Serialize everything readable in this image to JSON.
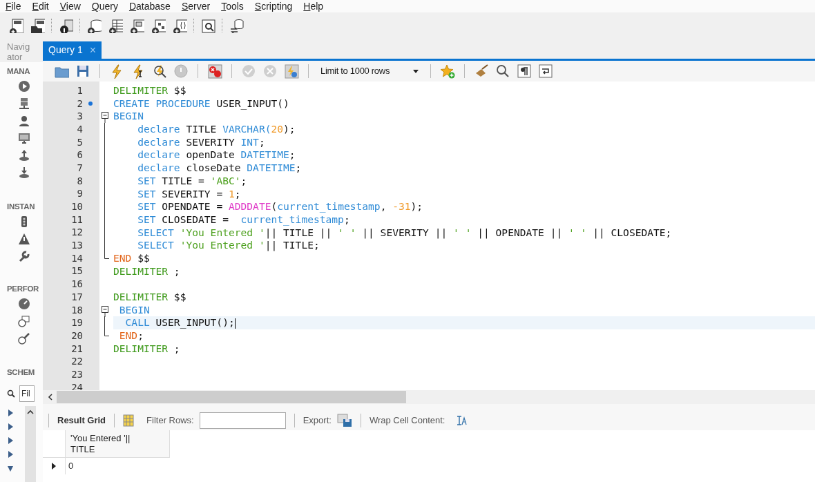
{
  "menu": [
    "File",
    "Edit",
    "View",
    "Query",
    "Database",
    "Server",
    "Tools",
    "Scripting",
    "Help"
  ],
  "navigator": {
    "title_lines": [
      "Navig",
      "ator"
    ],
    "sections": [
      {
        "label": "MANA"
      },
      {
        "label": "INSTAN"
      },
      {
        "label": "PERFOR"
      },
      {
        "label": "SCHEM"
      }
    ],
    "filter_placeholder": "Fil"
  },
  "tabs": [
    {
      "label": "Query 1",
      "close": "×",
      "selected": true
    }
  ],
  "limit_select": {
    "value": "Limit to 1000 rows"
  },
  "editor": {
    "lines": [
      {
        "number": "1",
        "kind": "plain",
        "tokens": [
          {
            "kind": "delimiter",
            "text": "DELIMITER"
          },
          {
            "kind": "text",
            "text": " $$"
          }
        ]
      },
      {
        "number": "2",
        "kind": "plain",
        "marker": true,
        "tokens": [
          {
            "kind": "keyword",
            "text": "CREATE PROCEDURE"
          },
          {
            "kind": "text",
            "text": " USER_INPUT()"
          }
        ]
      },
      {
        "number": "3",
        "kind": "opener",
        "tokens": [
          {
            "kind": "keyword",
            "text": "BEGIN"
          }
        ]
      },
      {
        "number": "4",
        "kind": "inner",
        "tokens": [
          {
            "kind": "keyword",
            "text": "    declare"
          },
          {
            "kind": "text",
            "text": " TITLE "
          },
          {
            "kind": "keyword",
            "text": "VARCHAR("
          },
          {
            "kind": "number",
            "text": "20"
          },
          {
            "kind": "text",
            "text": ");"
          }
        ]
      },
      {
        "number": "5",
        "kind": "inner",
        "tokens": [
          {
            "kind": "keyword",
            "text": "    declare"
          },
          {
            "kind": "text",
            "text": " SEVERITY "
          },
          {
            "kind": "keyword",
            "text": "INT"
          },
          {
            "kind": "text",
            "text": ";"
          }
        ]
      },
      {
        "number": "6",
        "kind": "inner",
        "tokens": [
          {
            "kind": "keyword",
            "text": "    declare"
          },
          {
            "kind": "text",
            "text": " openDate "
          },
          {
            "kind": "keyword",
            "text": "DATETIME"
          },
          {
            "kind": "text",
            "text": ";"
          }
        ]
      },
      {
        "number": "7",
        "kind": "inner",
        "tokens": [
          {
            "kind": "keyword",
            "text": "    declare"
          },
          {
            "kind": "text",
            "text": " closeDate "
          },
          {
            "kind": "keyword",
            "text": "DATETIME"
          },
          {
            "kind": "text",
            "text": ";"
          }
        ]
      },
      {
        "number": "8",
        "kind": "inner",
        "tokens": [
          {
            "kind": "keyword",
            "text": "    SET"
          },
          {
            "kind": "text",
            "text": " TITLE = "
          },
          {
            "kind": "string",
            "text": "'ABC'"
          },
          {
            "kind": "text",
            "text": ";"
          }
        ]
      },
      {
        "number": "9",
        "kind": "inner",
        "tokens": [
          {
            "kind": "keyword",
            "text": "    SET"
          },
          {
            "kind": "text",
            "text": " SEVERITY = "
          },
          {
            "kind": "number",
            "text": "1"
          },
          {
            "kind": "text",
            "text": ";"
          }
        ]
      },
      {
        "number": "10",
        "kind": "inner",
        "tokens": [
          {
            "kind": "keyword",
            "text": "    SET"
          },
          {
            "kind": "text",
            "text": " OPENDATE = "
          },
          {
            "kind": "function",
            "text": "ADDDATE"
          },
          {
            "kind": "text",
            "text": "("
          },
          {
            "kind": "keyword",
            "text": "current_timestamp"
          },
          {
            "kind": "text",
            "text": ", "
          },
          {
            "kind": "number",
            "text": "-31"
          },
          {
            "kind": "text",
            "text": ");"
          }
        ]
      },
      {
        "number": "11",
        "kind": "inner",
        "tokens": [
          {
            "kind": "keyword",
            "text": "    SET"
          },
          {
            "kind": "text",
            "text": " CLOSEDATE =  "
          },
          {
            "kind": "keyword",
            "text": "current_timestamp"
          },
          {
            "kind": "text",
            "text": ";"
          }
        ]
      },
      {
        "number": "12",
        "kind": "inner",
        "tokens": [
          {
            "kind": "keyword",
            "text": "    SELECT"
          },
          {
            "kind": "string",
            "text": " 'You Entered '"
          },
          {
            "kind": "text",
            "text": "|| TITLE || "
          },
          {
            "kind": "string",
            "text": "' '"
          },
          {
            "kind": "text",
            "text": " || SEVERITY || "
          },
          {
            "kind": "string",
            "text": "' '"
          },
          {
            "kind": "text",
            "text": " || OPENDATE || "
          },
          {
            "kind": "string",
            "text": "' '"
          },
          {
            "kind": "text",
            "text": " || CLOSEDATE;"
          }
        ]
      },
      {
        "number": "13",
        "kind": "inner",
        "tokens": [
          {
            "kind": "keyword",
            "text": "    SELECT"
          },
          {
            "kind": "string",
            "text": " 'You Entered '"
          },
          {
            "kind": "text",
            "text": "|| TITLE;"
          }
        ]
      },
      {
        "number": "14",
        "kind": "closer",
        "tokens": [
          {
            "kind": "end",
            "text": "END"
          },
          {
            "kind": "text",
            "text": " $$"
          }
        ]
      },
      {
        "number": "15",
        "kind": "plain",
        "tokens": [
          {
            "kind": "delimiter",
            "text": "DELIMITER"
          },
          {
            "kind": "text",
            "text": " ;"
          }
        ]
      },
      {
        "number": "16",
        "kind": "plain"
      },
      {
        "number": "17",
        "kind": "plain",
        "tokens": [
          {
            "kind": "delimiter",
            "text": "DELIMITER"
          },
          {
            "kind": "text",
            "text": " $$"
          }
        ]
      },
      {
        "number": "18",
        "kind": "opener",
        "tokens": [
          {
            "kind": "keyword",
            "text": " BEGIN"
          }
        ]
      },
      {
        "number": "19",
        "kind": "inner",
        "current": true,
        "tokens": [
          {
            "kind": "keyword",
            "text": "  CALL"
          },
          {
            "kind": "text",
            "text": " USER_INPUT();"
          }
        ]
      },
      {
        "number": "20",
        "kind": "closer",
        "tokens": [
          {
            "kind": "end",
            "text": " END"
          },
          {
            "kind": "text",
            "text": ";"
          }
        ]
      },
      {
        "number": "21",
        "kind": "plain",
        "tokens": [
          {
            "kind": "delimiter",
            "text": "DELIMITER"
          },
          {
            "kind": "text",
            "text": " ;"
          }
        ]
      },
      {
        "number": "22",
        "kind": "plain"
      },
      {
        "number": "23",
        "kind": "plain"
      },
      {
        "number": "24",
        "kind": "plain"
      }
    ]
  },
  "results": {
    "tab": "Result Grid",
    "filter_label": "Filter Rows:",
    "export_label": "Export:",
    "wrap_label": "Wrap Cell Content:",
    "columns": [
      {
        "lines": [
          "'You Entered '||",
          "TITLE"
        ]
      }
    ],
    "rows": [
      {
        "cells": [
          "0"
        ],
        "current": true
      }
    ]
  }
}
